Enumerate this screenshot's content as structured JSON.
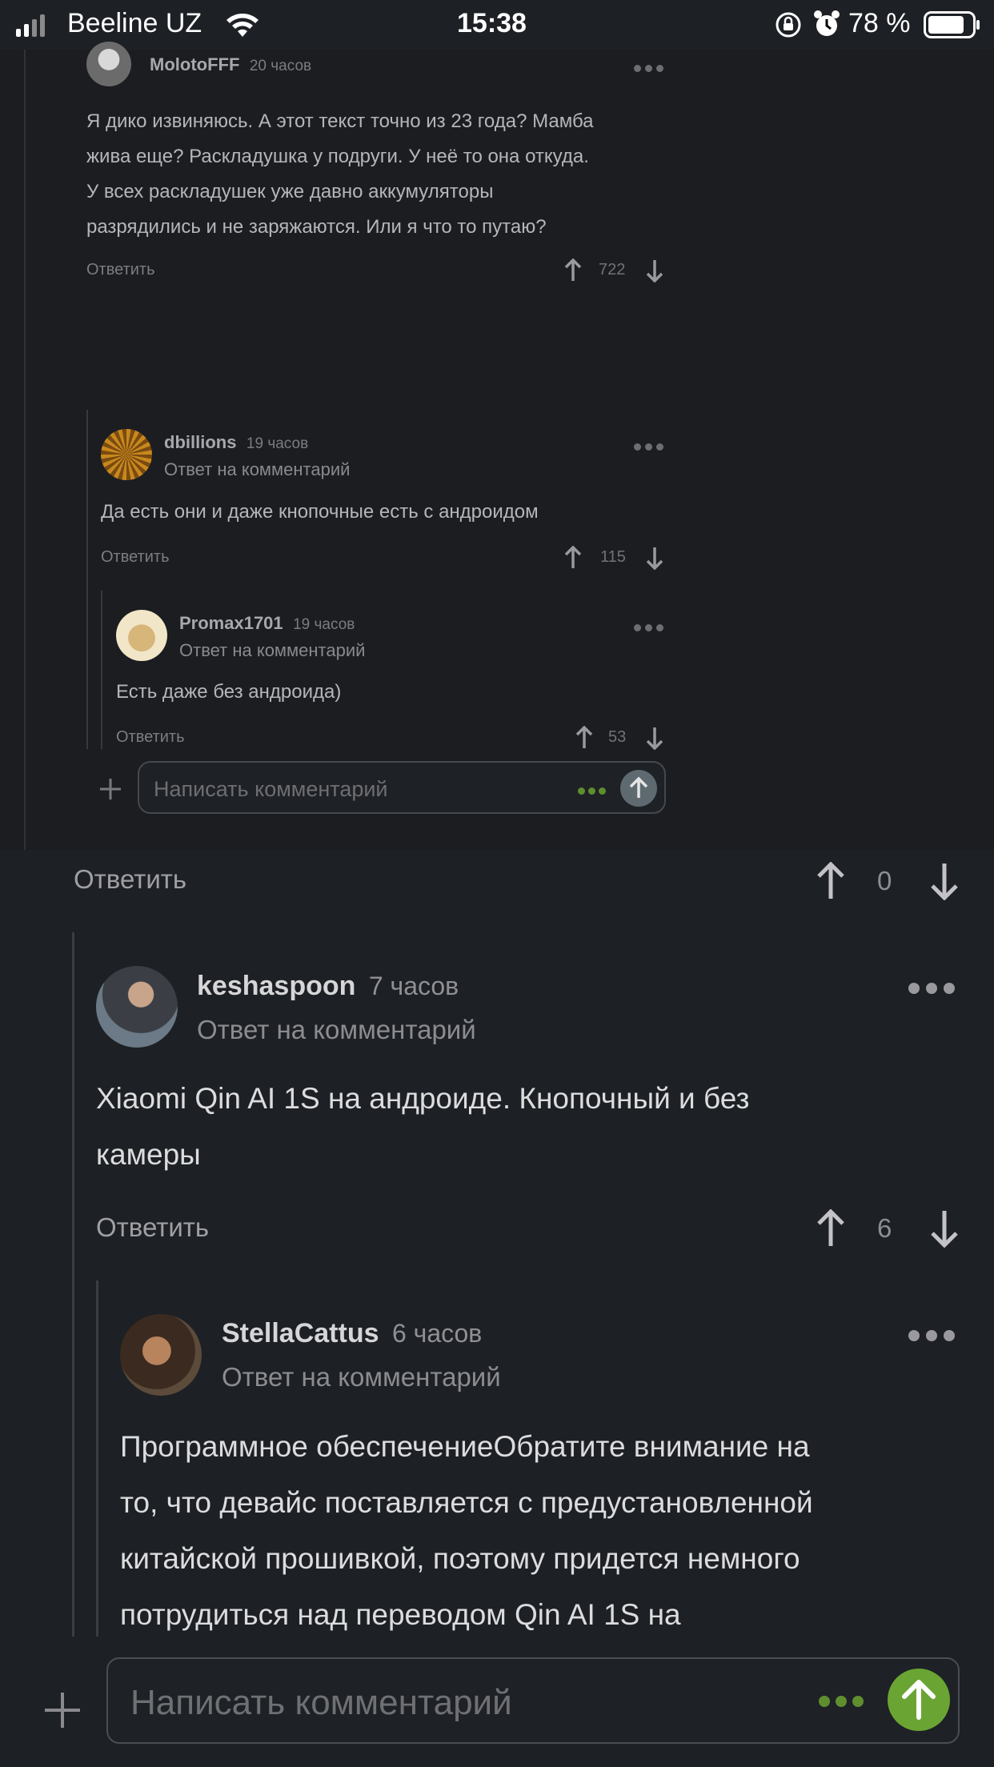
{
  "status_bar": {
    "carrier": "Beeline UZ",
    "time": "15:38",
    "battery": "78 %"
  },
  "comments": [
    {
      "author": "MolotoFFF",
      "time": "20 часов",
      "text_lines": [
        "Я дико извиняюсь. А этот текст точно из 23 года? Мамба",
        "жива еще? Раскладушка у подруги. У неё то она откуда.",
        "У всех раскладушек уже давно аккумуляторы",
        "разрядились и не заряжаются. Или я что то путаю?"
      ],
      "reply_label": "Ответить",
      "rating": "722"
    },
    {
      "author": "dbillions",
      "time": "19 часов",
      "subtitle": "Ответ на комментарий",
      "text": "Да есть они и даже кнопочные есть с андроидом",
      "reply_label": "Ответить",
      "rating": "115"
    },
    {
      "author": "Promax1701",
      "time": "19 часов",
      "subtitle": "Ответ на комментарий",
      "text": "Есть даже без андроида)",
      "reply_label": "Ответить",
      "rating": "53"
    }
  ],
  "embedded_input": {
    "placeholder": "Написать комментарий"
  },
  "parent_actions": {
    "reply_label": "Ответить",
    "rating": "0"
  },
  "replies": [
    {
      "author": "keshaspoon",
      "time": "7 часов",
      "subtitle": "Ответ на комментарий",
      "text_lines": [
        "Xiaomi Qin AI 1S на андроиде. Кнопочный и без",
        "камеры"
      ],
      "reply_label": "Ответить",
      "rating": "6"
    },
    {
      "author": "StellaCattus",
      "time": "6 часов",
      "subtitle": "Ответ на комментарий",
      "text_lines": [
        "Программное обеспечениеОбратите внимание на",
        "то, что девайс поставляется с предустановленной",
        "китайской прошивкой, поэтому придется немного",
        "потрудиться над переводом Qin AI 1S на"
      ]
    }
  ],
  "comment_input": {
    "placeholder": "Написать комментарий"
  },
  "colors": {
    "background": "#1d2024",
    "send_button": "#6aa534",
    "dots_accent": "#5f8e2f"
  },
  "icons": [
    "signal-icon",
    "wifi-icon",
    "rotation-lock-icon",
    "alarm-icon",
    "battery-icon",
    "upvote-icon",
    "downvote-icon",
    "more-icon",
    "plus-icon",
    "send-icon"
  ]
}
